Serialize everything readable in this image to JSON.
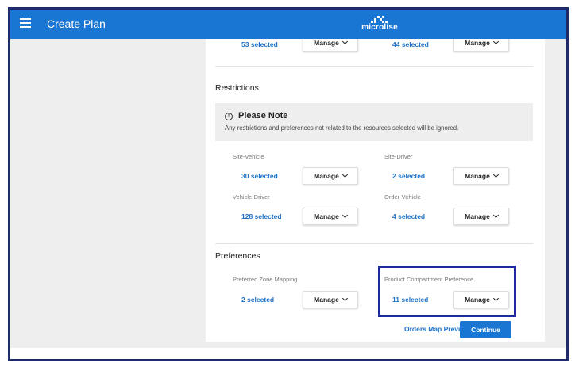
{
  "header": {
    "title": "Create Plan",
    "brand": "microlise",
    "brand_color": "#1976d2"
  },
  "top_row": [
    {
      "selected": "53 selected",
      "manage": "Manage"
    },
    {
      "selected": "44 selected",
      "manage": "Manage"
    }
  ],
  "restrictions": {
    "title": "Restrictions",
    "note_title": "Please Note",
    "note_text": "Any restrictions and preferences not related to the resources selected will be ignored.",
    "items": [
      {
        "label": "Site-Vehicle",
        "selected": "30 selected",
        "manage": "Manage"
      },
      {
        "label": "Site-Driver",
        "selected": "2 selected",
        "manage": "Manage"
      },
      {
        "label": "Vehicle-Driver",
        "selected": "128 selected",
        "manage": "Manage"
      },
      {
        "label": "Order-Vehicle",
        "selected": "4 selected",
        "manage": "Manage"
      }
    ]
  },
  "preferences": {
    "title": "Preferences",
    "items": [
      {
        "label": "Preferred Zone Mapping",
        "selected": "2 selected",
        "manage": "Manage"
      },
      {
        "label": "Product Compartment Preference",
        "selected": "11 selected",
        "manage": "Manage"
      }
    ]
  },
  "footer": {
    "preview_link": "Orders Map Preview",
    "continue": "Continue"
  }
}
